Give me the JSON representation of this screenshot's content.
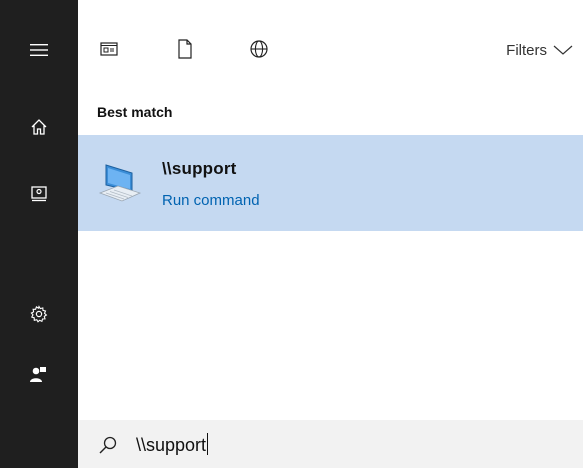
{
  "rail": {
    "items": [
      {
        "name": "menu-icon"
      },
      {
        "name": "home-icon"
      },
      {
        "name": "documents-icon"
      },
      {
        "name": "settings-icon"
      },
      {
        "name": "user-icon"
      }
    ]
  },
  "toolbar": {
    "icons": [
      "apps-filter-icon",
      "document-filter-icon",
      "web-filter-icon"
    ],
    "filters_label": "Filters"
  },
  "results": {
    "section_title": "Best match",
    "best_match": {
      "title": "\\\\support",
      "subtitle": "Run command",
      "icon": "computer-icon"
    }
  },
  "search": {
    "value": "\\\\support"
  },
  "colors": {
    "rail_bg": "#1f1f1f",
    "selection_bg": "#c5d9f1",
    "link_blue": "#0063b1",
    "searchbar_bg": "#f2f2f2"
  }
}
